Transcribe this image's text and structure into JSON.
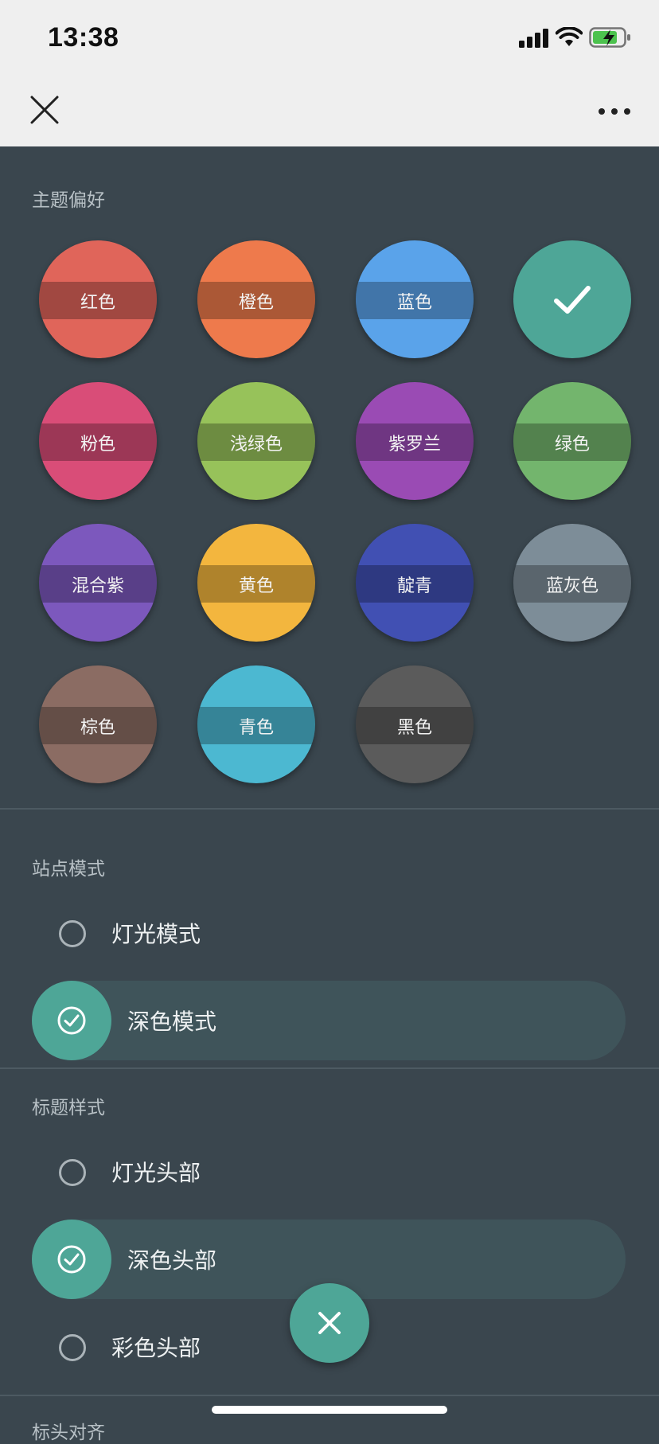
{
  "status_bar": {
    "time": "13:38"
  },
  "theme": {
    "title": "主题偏好",
    "swatches": [
      {
        "label": "红色",
        "color": "#e0655a",
        "selected": false
      },
      {
        "label": "橙色",
        "color": "#ee7a4c",
        "selected": false
      },
      {
        "label": "蓝色",
        "color": "#5aa3ea",
        "selected": false
      },
      {
        "label": "",
        "color": "#4ea697",
        "selected": true
      },
      {
        "label": "粉色",
        "color": "#d94d78",
        "selected": false
      },
      {
        "label": "浅绿色",
        "color": "#97c25a",
        "selected": false
      },
      {
        "label": "紫罗兰",
        "color": "#9a4bb4",
        "selected": false
      },
      {
        "label": "绿色",
        "color": "#73b56d",
        "selected": false
      },
      {
        "label": "混合紫",
        "color": "#7c58bd",
        "selected": false
      },
      {
        "label": "黄色",
        "color": "#f3b63e",
        "selected": false
      },
      {
        "label": "靛青",
        "color": "#4150b3",
        "selected": false
      },
      {
        "label": "蓝灰色",
        "color": "#7d8d98",
        "selected": false
      },
      {
        "label": "棕色",
        "color": "#8b6c63",
        "selected": false
      },
      {
        "label": "青色",
        "color": "#4cb8d1",
        "selected": false
      },
      {
        "label": "黑色",
        "color": "#5b5b5b",
        "selected": false
      }
    ]
  },
  "site_mode": {
    "title": "站点模式",
    "options": [
      {
        "label": "灯光模式",
        "selected": false
      },
      {
        "label": "深色模式",
        "selected": true
      }
    ]
  },
  "header_style": {
    "title": "标题样式",
    "options": [
      {
        "label": "灯光头部",
        "selected": false
      },
      {
        "label": "深色头部",
        "selected": true
      },
      {
        "label": "彩色头部",
        "selected": false
      }
    ]
  },
  "next_section_title": "标头对齐",
  "accent_color": "#4ea697",
  "background_color": "#3a464e"
}
